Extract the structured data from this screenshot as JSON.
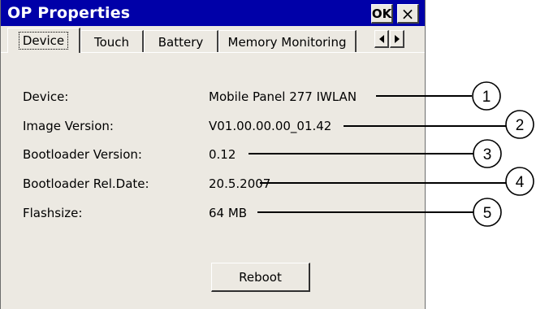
{
  "window": {
    "title": "OP Properties",
    "ok_label": "OK",
    "close_label": "×"
  },
  "tabs": [
    {
      "label": "Device",
      "active": true
    },
    {
      "label": "Touch",
      "active": false
    },
    {
      "label": "Battery",
      "active": false
    },
    {
      "label": "Memory Monitoring",
      "active": false
    }
  ],
  "tab_scroll": {
    "left": "◄",
    "right": "►"
  },
  "rows": [
    {
      "label": "Device:",
      "value": "Mobile Panel 277 IWLAN"
    },
    {
      "label": "Image Version:",
      "value": "V01.00.00.00_01.42"
    },
    {
      "label": "Bootloader Version:",
      "value": "0.12"
    },
    {
      "label": "Bootloader Rel.Date:",
      "value": "20.5.2007"
    },
    {
      "label": "Flashsize:",
      "value": "64 MB"
    }
  ],
  "reboot_label": "Reboot",
  "callouts": [
    "1",
    "2",
    "3",
    "4",
    "5"
  ],
  "colors": {
    "titlebar": "#0000a8",
    "dialog": "#ece9e2"
  }
}
